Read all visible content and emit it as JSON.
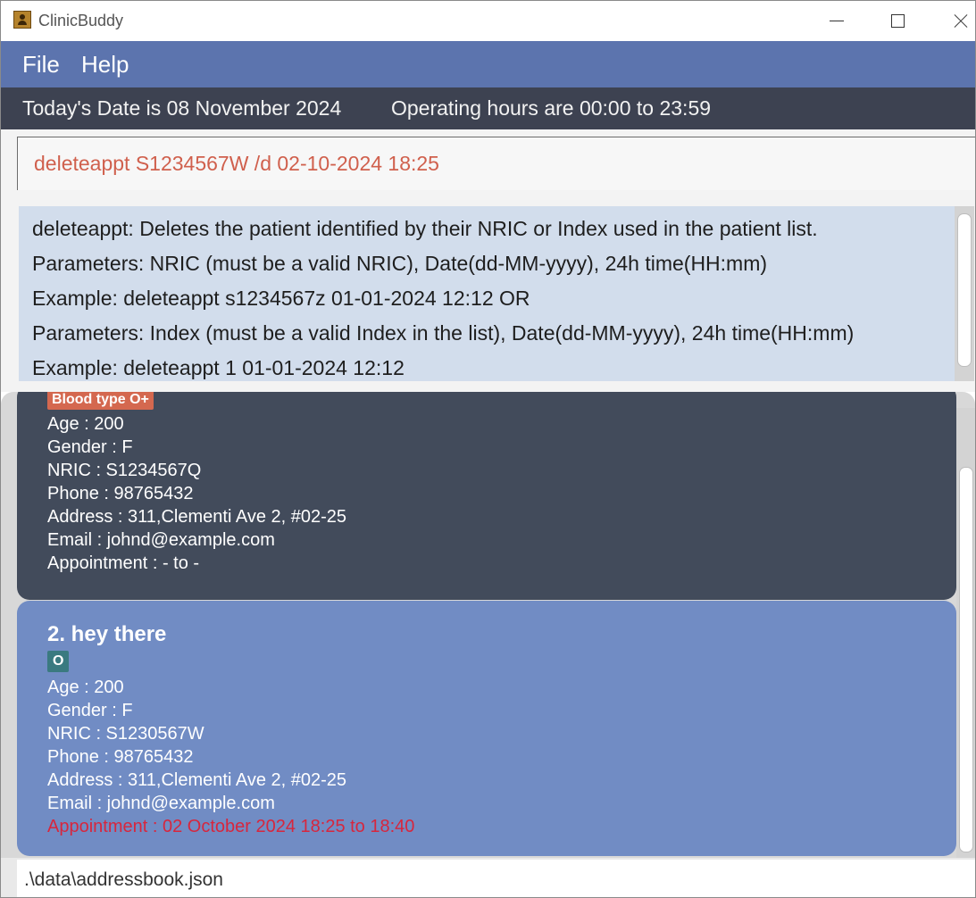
{
  "window": {
    "title": "ClinicBuddy"
  },
  "menu": {
    "file": "File",
    "help": "Help"
  },
  "status": {
    "date_text": "Today's Date is 08 November 2024",
    "hours_text": "Operating hours are 00:00 to 23:59"
  },
  "command": {
    "value": "deleteappt S1234567W /d 02-10-2024 18:25"
  },
  "result": {
    "lines": [
      "deleteappt: Deletes the patient identified by their NRIC or Index used in the patient list.",
      "Parameters: NRIC (must be a valid NRIC), Date(dd-MM-yyyy), 24h time(HH:mm)",
      "Example: deleteappt s1234567z 01-01-2024 12:12 OR",
      "Parameters: Index (must be a valid Index in the list), Date(dd-MM-yyyy), 24h time(HH:mm)",
      "Example: deleteappt 1 01-01-2024 12:12"
    ]
  },
  "patients": [
    {
      "tag": "Blood type O+",
      "age": "Age : 200",
      "gender": "Gender : F",
      "nric": "NRIC : S1234567Q",
      "phone": "Phone : 98765432",
      "address": "Address : 311,Clementi Ave 2, #02-25",
      "email": "Email : johnd@example.com",
      "appointment": "Appointment : - to -"
    },
    {
      "name": "2. hey there",
      "tag": "O",
      "age": "Age : 200",
      "gender": "Gender : F",
      "nric": "NRIC : S1230567W",
      "phone": "Phone : 98765432",
      "address": "Address : 311,Clementi Ave 2, #02-25",
      "email": "Email : johnd@example.com",
      "appointment": "Appointment : 02 October 2024 18:25 to 18:40"
    }
  ],
  "footer": {
    "path": ".\\data\\addressbook.json"
  },
  "icons": {
    "app": "app-icon",
    "minimize": "minimize-icon",
    "maximize": "maximize-icon",
    "close": "close-icon"
  },
  "colors": {
    "menu_bar": "#5c74ae",
    "status_bar": "#3d4251",
    "command_text": "#d0604d",
    "result_bg": "#d2ddec",
    "card_dark": "#424b5b",
    "card_selected": "#718cc4",
    "appointment_highlight": "#d7263d"
  }
}
